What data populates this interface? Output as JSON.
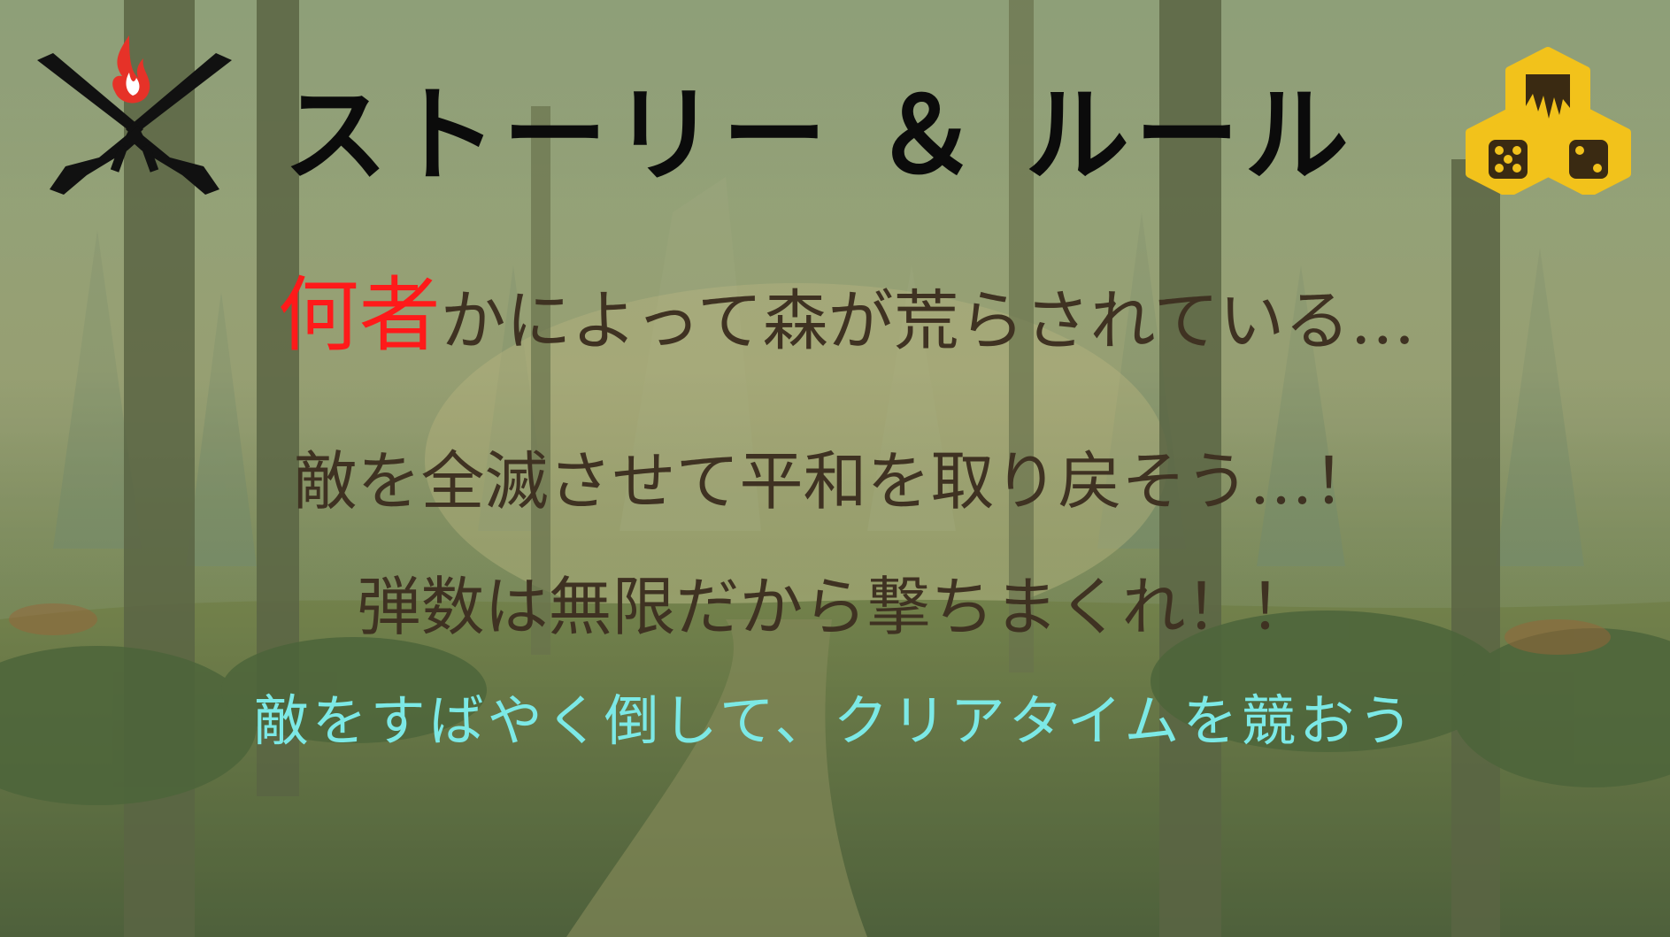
{
  "title": "ストーリー ＆ ルール",
  "story": {
    "line1_highlight": "何者",
    "line1_rest": "かによって森が荒らされている…",
    "line2": "敵を全滅させて平和を取り戻そう…！",
    "line3": "弾数は無限だから撃ちまくれ！！"
  },
  "rule": {
    "text": "敵をすばやく倒して、クリアタイムを競おう"
  },
  "icons": {
    "left_logo": "crossed-rifles-flame-icon",
    "right_logo": "hexagon-dice-icon"
  },
  "colors": {
    "title": "#0b0b0b",
    "story_text": "#3f3222",
    "highlight": "#ff1a1a",
    "rule_text": "#7ce9e6",
    "hex_yellow": "#f2c21b",
    "hex_dark": "#3a2a12"
  }
}
